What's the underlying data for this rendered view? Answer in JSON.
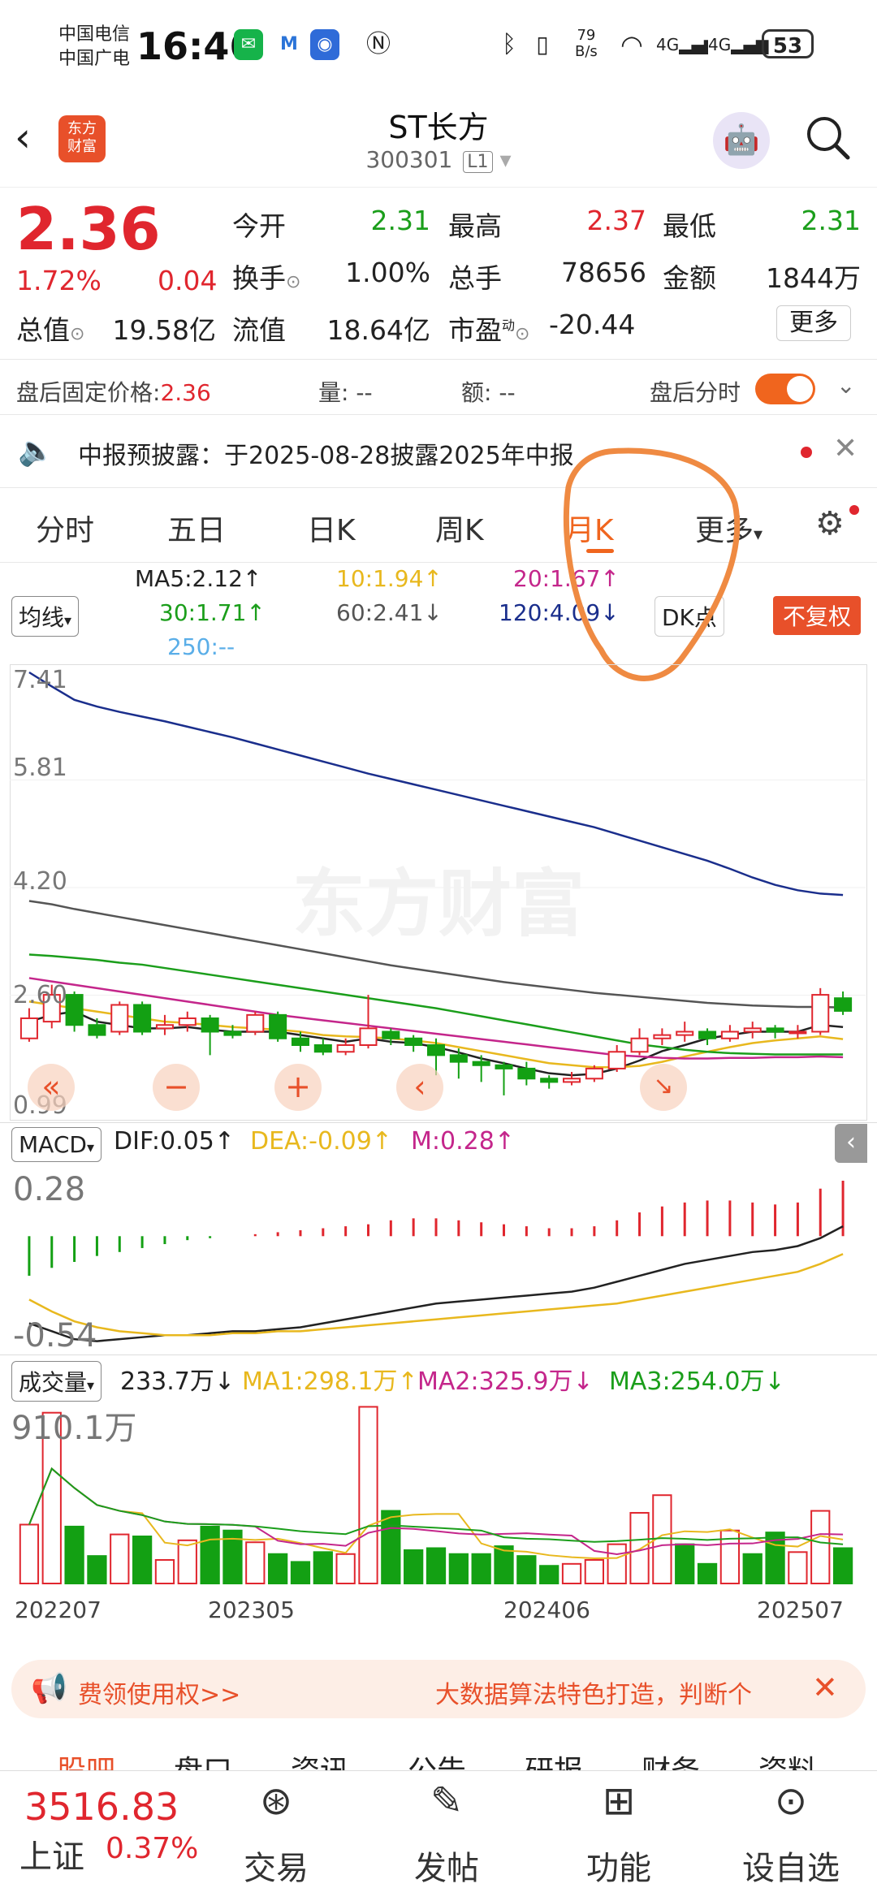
{
  "status": {
    "carrier1": "中国电信",
    "carrier2": "中国广电",
    "time": "16:46",
    "speed_top": "79",
    "speed_bottom": "B/s",
    "battery": "53"
  },
  "header": {
    "logo_line1": "东方",
    "logo_line2": "财富",
    "title": "ST长方",
    "code": "300301",
    "code_badge": "L1"
  },
  "quote": {
    "price": "2.36",
    "change_pct": "1.72%",
    "change": "0.04",
    "open_label": "今开",
    "open": "2.31",
    "high_label": "最高",
    "high": "2.37",
    "low_label": "最低",
    "low": "2.31",
    "turnover_label": "换手",
    "turnover": "1.00%",
    "volume_label": "总手",
    "volume": "78656",
    "amount_label": "金额",
    "amount": "1844万",
    "mktcap_label": "总值",
    "mktcap": "19.58亿",
    "float_label": "流值",
    "float": "18.64亿",
    "pe_label": "市盈",
    "pe_sup": "动",
    "pe": "-20.44",
    "more": "更多"
  },
  "afterhours": {
    "price_label": "盘后固定价格:",
    "price": "2.36",
    "vol_label": "量:",
    "vol": "--",
    "amt_label": "额:",
    "amt": "--",
    "toggle_label": "盘后分时"
  },
  "notice": {
    "text": "中报预披露：于2025-08-28披露2025年中报"
  },
  "tabs": [
    "分时",
    "五日",
    "日K",
    "周K",
    "月K",
    "更多"
  ],
  "ma": {
    "ma5": "MA5:2.12↑",
    "ma10": "10:1.94↑",
    "ma20": "20:1.67↑",
    "ma30": "30:1.71↑",
    "ma60": "60:2.41↓",
    "ma120": "120:4.09↓",
    "ma250": "250:--",
    "select": "均线",
    "dk": "DK点",
    "fq": "不复权"
  },
  "chart_data": {
    "type": "candlestick",
    "watermark": "东方财富",
    "ylim": [
      0.99,
      7.41
    ],
    "y_ticks": [
      "7.41",
      "5.81",
      "4.20",
      "2.60",
      "0.99"
    ],
    "x_ticks": [
      "202207",
      "202305",
      "202406",
      "202507"
    ],
    "candles": [
      {
        "o": 1.95,
        "c": 2.25,
        "h": 2.4,
        "l": 1.9
      },
      {
        "o": 2.2,
        "c": 2.6,
        "h": 2.75,
        "l": 2.1
      },
      {
        "o": 2.6,
        "c": 2.15,
        "h": 2.65,
        "l": 2.05
      },
      {
        "o": 2.15,
        "c": 2.0,
        "h": 2.25,
        "l": 1.95
      },
      {
        "o": 2.05,
        "c": 2.45,
        "h": 2.5,
        "l": 2.0
      },
      {
        "o": 2.45,
        "c": 2.05,
        "h": 2.5,
        "l": 2.0
      },
      {
        "o": 2.1,
        "c": 2.15,
        "h": 2.3,
        "l": 2.0
      },
      {
        "o": 2.15,
        "c": 2.25,
        "h": 2.35,
        "l": 2.05
      },
      {
        "o": 2.25,
        "c": 2.05,
        "h": 2.3,
        "l": 1.7
      },
      {
        "o": 2.05,
        "c": 2.0,
        "h": 2.15,
        "l": 1.95
      },
      {
        "o": 2.05,
        "c": 2.3,
        "h": 2.35,
        "l": 2.0
      },
      {
        "o": 2.3,
        "c": 1.95,
        "h": 2.35,
        "l": 1.9
      },
      {
        "o": 1.95,
        "c": 1.85,
        "h": 2.05,
        "l": 1.75
      },
      {
        "o": 1.85,
        "c": 1.75,
        "h": 1.95,
        "l": 1.7
      },
      {
        "o": 1.75,
        "c": 1.85,
        "h": 1.95,
        "l": 1.7
      },
      {
        "o": 1.85,
        "c": 2.1,
        "h": 2.6,
        "l": 1.8
      },
      {
        "o": 2.05,
        "c": 1.95,
        "h": 2.1,
        "l": 1.85
      },
      {
        "o": 1.95,
        "c": 1.85,
        "h": 2.0,
        "l": 1.75
      },
      {
        "o": 1.85,
        "c": 1.7,
        "h": 1.95,
        "l": 1.4
      },
      {
        "o": 1.7,
        "c": 1.6,
        "h": 1.8,
        "l": 1.35
      },
      {
        "o": 1.6,
        "c": 1.55,
        "h": 1.7,
        "l": 1.3
      },
      {
        "o": 1.55,
        "c": 1.5,
        "h": 1.6,
        "l": 1.1
      },
      {
        "o": 1.5,
        "c": 1.35,
        "h": 1.6,
        "l": 1.25
      },
      {
        "o": 1.35,
        "c": 1.3,
        "h": 1.4,
        "l": 1.2
      },
      {
        "o": 1.3,
        "c": 1.35,
        "h": 1.45,
        "l": 1.25
      },
      {
        "o": 1.35,
        "c": 1.5,
        "h": 1.55,
        "l": 1.3
      },
      {
        "o": 1.5,
        "c": 1.75,
        "h": 1.85,
        "l": 1.45
      },
      {
        "o": 1.75,
        "c": 1.95,
        "h": 2.1,
        "l": 1.7
      },
      {
        "o": 1.95,
        "c": 2.0,
        "h": 2.1,
        "l": 1.85
      },
      {
        "o": 2.0,
        "c": 2.05,
        "h": 2.2,
        "l": 1.9
      },
      {
        "o": 2.05,
        "c": 1.95,
        "h": 2.1,
        "l": 1.85
      },
      {
        "o": 1.95,
        "c": 2.05,
        "h": 2.15,
        "l": 1.9
      },
      {
        "o": 2.05,
        "c": 2.1,
        "h": 2.2,
        "l": 1.95
      },
      {
        "o": 2.1,
        "c": 2.05,
        "h": 2.15,
        "l": 1.95
      },
      {
        "o": 2.05,
        "c": 2.05,
        "h": 2.15,
        "l": 1.95
      },
      {
        "o": 2.05,
        "c": 2.6,
        "h": 2.7,
        "l": 2.0
      },
      {
        "o": 2.55,
        "c": 2.36,
        "h": 2.65,
        "l": 2.3
      }
    ],
    "ma_series": [
      {
        "name": "MA5",
        "color": "#222222",
        "values": [
          2.2,
          2.3,
          2.35,
          2.2,
          2.15,
          2.1,
          2.1,
          2.12,
          2.08,
          2.05,
          2.05,
          2.05,
          2.0,
          1.95,
          1.9,
          1.95,
          1.9,
          1.88,
          1.82,
          1.74,
          1.65,
          1.58,
          1.5,
          1.43,
          1.4,
          1.42,
          1.5,
          1.62,
          1.76,
          1.85,
          1.95,
          2.0,
          2.05,
          2.05,
          2.05,
          2.15,
          2.12
        ]
      },
      {
        "name": "10",
        "color": "#e8b81e",
        "values": [
          2.5,
          2.45,
          2.4,
          2.35,
          2.3,
          2.25,
          2.2,
          2.18,
          2.15,
          2.12,
          2.1,
          2.08,
          2.05,
          2.0,
          1.98,
          1.97,
          1.95,
          1.92,
          1.88,
          1.82,
          1.76,
          1.7,
          1.64,
          1.58,
          1.55,
          1.52,
          1.52,
          1.54,
          1.6,
          1.68,
          1.75,
          1.82,
          1.88,
          1.92,
          1.95,
          1.98,
          1.94
        ]
      },
      {
        "name": "20",
        "color": "#c4268b",
        "values": [
          2.85,
          2.8,
          2.75,
          2.7,
          2.65,
          2.6,
          2.55,
          2.5,
          2.45,
          2.4,
          2.35,
          2.3,
          2.26,
          2.22,
          2.18,
          2.14,
          2.1,
          2.06,
          2.02,
          1.98,
          1.94,
          1.9,
          1.86,
          1.82,
          1.78,
          1.74,
          1.7,
          1.68,
          1.66,
          1.65,
          1.65,
          1.66,
          1.66,
          1.67,
          1.67,
          1.68,
          1.67
        ]
      },
      {
        "name": "30",
        "color": "#1b9e1b",
        "values": [
          3.2,
          3.18,
          3.15,
          3.12,
          3.08,
          3.05,
          3.0,
          2.95,
          2.9,
          2.85,
          2.8,
          2.75,
          2.7,
          2.65,
          2.6,
          2.55,
          2.5,
          2.45,
          2.4,
          2.34,
          2.28,
          2.22,
          2.16,
          2.1,
          2.04,
          1.98,
          1.92,
          1.86,
          1.82,
          1.78,
          1.75,
          1.73,
          1.72,
          1.71,
          1.71,
          1.71,
          1.71
        ]
      },
      {
        "name": "60",
        "color": "#555555",
        "values": [
          4.0,
          3.95,
          3.88,
          3.82,
          3.76,
          3.7,
          3.64,
          3.58,
          3.52,
          3.46,
          3.4,
          3.34,
          3.28,
          3.22,
          3.16,
          3.1,
          3.04,
          2.99,
          2.94,
          2.89,
          2.84,
          2.79,
          2.75,
          2.71,
          2.67,
          2.63,
          2.6,
          2.57,
          2.54,
          2.51,
          2.48,
          2.46,
          2.44,
          2.43,
          2.42,
          2.42,
          2.41
        ]
      },
      {
        "name": "120",
        "color": "#1a2e8c",
        "values": [
          7.41,
          7.2,
          7.0,
          6.9,
          6.82,
          6.75,
          6.68,
          6.6,
          6.52,
          6.44,
          6.35,
          6.26,
          6.17,
          6.08,
          5.99,
          5.9,
          5.82,
          5.74,
          5.66,
          5.58,
          5.5,
          5.42,
          5.34,
          5.26,
          5.18,
          5.1,
          5.0,
          4.9,
          4.8,
          4.7,
          4.6,
          4.48,
          4.35,
          4.24,
          4.16,
          4.11,
          4.09
        ]
      }
    ],
    "macd": {
      "dif": "DIF:0.05↑",
      "dea": "DEA:-0.09↑",
      "m": "M:0.28↑",
      "select": "MACD",
      "y_ticks": [
        "0.28",
        "-0.54"
      ],
      "ylim": [
        -0.54,
        0.28
      ],
      "hist": [
        -0.2,
        -0.16,
        -0.13,
        -0.1,
        -0.08,
        -0.06,
        -0.04,
        -0.02,
        -0.01,
        0.0,
        0.01,
        0.02,
        0.03,
        0.04,
        0.05,
        0.06,
        0.08,
        0.09,
        0.09,
        0.08,
        0.07,
        0.06,
        0.05,
        0.04,
        0.04,
        0.05,
        0.08,
        0.12,
        0.15,
        0.17,
        0.18,
        0.18,
        0.17,
        0.16,
        0.17,
        0.24,
        0.28
      ],
      "dif_line": [
        -0.44,
        -0.48,
        -0.52,
        -0.53,
        -0.52,
        -0.51,
        -0.5,
        -0.5,
        -0.49,
        -0.48,
        -0.48,
        -0.47,
        -0.46,
        -0.44,
        -0.42,
        -0.4,
        -0.38,
        -0.36,
        -0.34,
        -0.33,
        -0.32,
        -0.31,
        -0.3,
        -0.29,
        -0.28,
        -0.26,
        -0.23,
        -0.2,
        -0.17,
        -0.14,
        -0.12,
        -0.1,
        -0.08,
        -0.07,
        -0.05,
        -0.01,
        0.05
      ],
      "dea_line": [
        -0.32,
        -0.38,
        -0.43,
        -0.46,
        -0.48,
        -0.49,
        -0.5,
        -0.5,
        -0.5,
        -0.49,
        -0.49,
        -0.48,
        -0.48,
        -0.47,
        -0.46,
        -0.45,
        -0.44,
        -0.43,
        -0.42,
        -0.41,
        -0.4,
        -0.39,
        -0.38,
        -0.37,
        -0.36,
        -0.35,
        -0.34,
        -0.32,
        -0.3,
        -0.28,
        -0.26,
        -0.24,
        -0.22,
        -0.2,
        -0.18,
        -0.14,
        -0.09
      ]
    },
    "volume": {
      "select": "成交量",
      "current": "233.7万↓",
      "ma1": "MA1:298.1万↑",
      "ma2": "MA2:325.9万↓",
      "ma3": "MA3:254.0万↓",
      "y_max_label": "910.1万",
      "ylim": [
        0,
        910.1
      ],
      "values": [
        300,
        870,
        290,
        140,
        250,
        240,
        120,
        220,
        290,
        270,
        210,
        150,
        110,
        160,
        150,
        900,
        370,
        170,
        180,
        150,
        150,
        190,
        140,
        90,
        100,
        120,
        200,
        360,
        450,
        200,
        100,
        270,
        150,
        260,
        160,
        370,
        180
      ],
      "up": [
        true,
        true,
        false,
        false,
        true,
        false,
        true,
        true,
        false,
        false,
        true,
        false,
        false,
        false,
        true,
        true,
        false,
        false,
        false,
        false,
        false,
        false,
        false,
        false,
        true,
        true,
        true,
        true,
        true,
        false,
        false,
        true,
        false,
        false,
        true,
        true,
        false
      ]
    }
  },
  "banner": {
    "left": "费领使用权>>",
    "right": "大数据算法特色打造，判断个"
  },
  "subtabs": [
    "股吧",
    "盘口",
    "资讯",
    "公告",
    "研报",
    "财务",
    "资料"
  ],
  "index": {
    "value": "3516.83",
    "name": "上证",
    "pct": "0.37%"
  },
  "nav": [
    "交易",
    "发帖",
    "功能",
    "设自选"
  ],
  "colors": {
    "up": "#e0262e",
    "down": "#13a013",
    "accent": "#f0651e"
  }
}
